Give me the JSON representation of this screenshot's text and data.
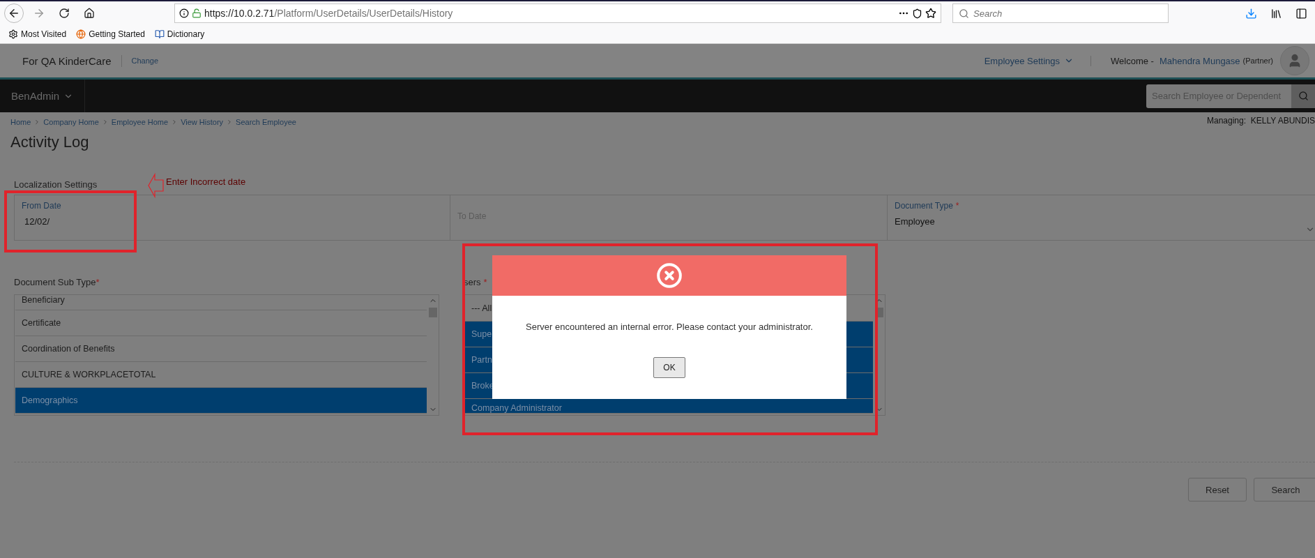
{
  "browser": {
    "address_host": "https://10.0.2.71",
    "address_path": "/Platform/UserDetails/UserDetails/History",
    "search_placeholder": "Search",
    "bookmarks": [
      {
        "label": "Most Visited",
        "kind": "gear"
      },
      {
        "label": "Getting Started",
        "kind": "globe"
      },
      {
        "label": "Dictionary",
        "kind": "book"
      }
    ]
  },
  "header": {
    "company": "For QA KinderCare",
    "change_link": "Change",
    "employee_settings": "Employee Settings",
    "welcome": "Welcome -",
    "user_name": "Mahendra Mungase",
    "user_role": "(Partner)"
  },
  "nav": {
    "app_menu": "BenAdmin",
    "search_placeholder": "Search Employee or Dependent"
  },
  "breadcrumb": [
    "Home",
    "Company Home",
    "Employee Home",
    "View History",
    "Search Employee"
  ],
  "managing": "Managing:  KELLY ABUNDIS",
  "page_title": "Activity Log",
  "section_title": "Localization Settings",
  "annotation": "Enter Incorrect date",
  "fields": {
    "from_date": {
      "label": "From Date",
      "value": "12/02/"
    },
    "to_date": {
      "placeholder": "To Date"
    },
    "document_type": {
      "label": "Document Type",
      "required_mark": "*",
      "value": "Employee"
    }
  },
  "sub_type": {
    "label": "Document Sub Type",
    "required_mark": "*",
    "items": [
      {
        "label": "Beneficiary",
        "selected": false
      },
      {
        "label": "Certificate",
        "selected": false
      },
      {
        "label": "Coordination of Benefits",
        "selected": false
      },
      {
        "label": "CULTURE & WORKPLACETOTAL",
        "selected": false
      },
      {
        "label": "Demographics",
        "selected": true
      }
    ]
  },
  "users": {
    "label": "sers",
    "required_mark": "*",
    "items": [
      {
        "label": "--- All",
        "selected": false
      },
      {
        "label": "Supe",
        "selected": true
      },
      {
        "label": "Partn",
        "selected": true
      },
      {
        "label": "Broke",
        "selected": true
      },
      {
        "label": "Company Administrator",
        "selected": true
      }
    ]
  },
  "dialog": {
    "message": "Server encountered an internal error. Please contact your administrator.",
    "ok": "OK"
  },
  "buttons": [
    "Reset",
    "Search"
  ]
}
